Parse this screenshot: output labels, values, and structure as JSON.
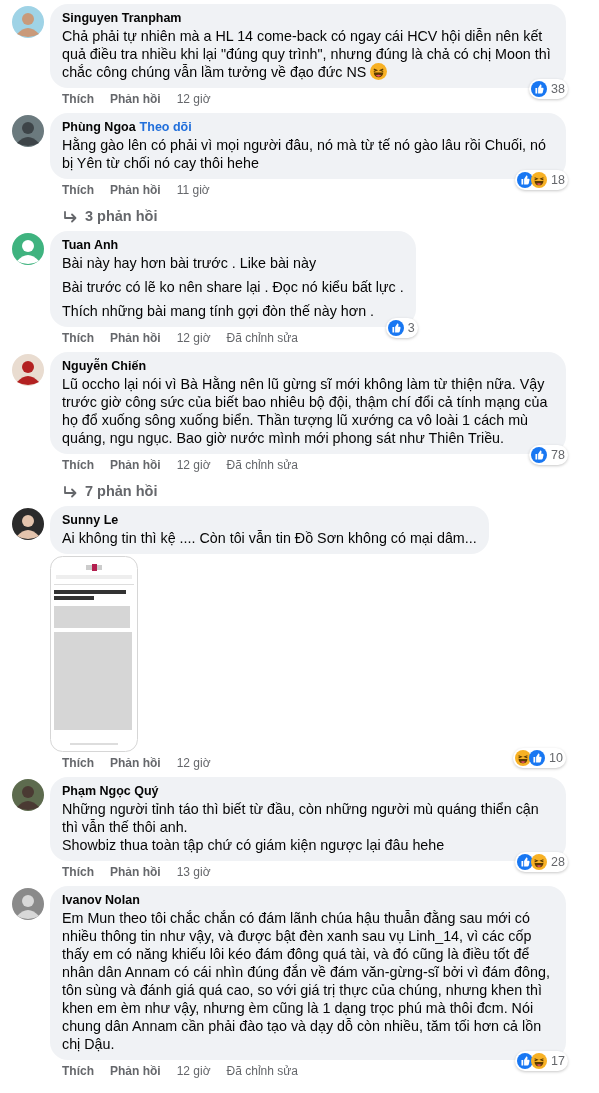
{
  "comments": [
    {
      "author": "Singuyen Tranpham",
      "paragraphs": [
        "Chả phải tự nhiên mà a HL 14 come-back có ngay cái HCV hội diễn nên kết quả điều tra nhiều khi lại \"đúng quy trình\", nhưng đúng là chả có chị Moon thì chắc công chúng vẫn lầm tưởng về đạo đức NS"
      ],
      "trailing_emoji": true,
      "like_label": "Thích",
      "reply_label": "Phản hồi",
      "time": "12 giờ",
      "reactions": [
        {
          "kind": "like"
        }
      ],
      "reaction_count": "38"
    },
    {
      "author": "Phùng Ngoa",
      "follow": "Theo dõi",
      "paragraphs": [
        "Hằng gào lên có phải vì mọi người đâu, nó mà từ tế nó gào lâu rồi Chuối, nó bị Yên từ chối nó cay thôi hehe"
      ],
      "trailing_emoji": false,
      "like_label": "Thích",
      "reply_label": "Phản hồi",
      "time": "11 giờ",
      "reactions": [
        {
          "kind": "like"
        },
        {
          "kind": "haha"
        }
      ],
      "reaction_count": "18",
      "replies": "3 phản hồi"
    },
    {
      "author": "Tuan Anh",
      "paragraphs": [
        "Bài này hay hơn bài trước . Like bài này",
        "Bài trước có lẽ ko nên share lại . Đọc nó kiểu bất lực .",
        "Thích những bài mang tính gợi đòn thế này hơn ."
      ],
      "trailing_emoji": false,
      "paragraph_gap": true,
      "like_label": "Thích",
      "reply_label": "Phản hồi",
      "time": "12 giờ",
      "edited": "Đã chỉnh sửa",
      "reactions": [
        {
          "kind": "like"
        }
      ],
      "reaction_count": "3"
    },
    {
      "author": "Nguyễn Chiến",
      "paragraphs": [
        "Lũ occho lại nói vì Bà Hằng nên lũ gừng sĩ mới không làm từ thiện nữa. Vậy trước giờ công sức của biết bao nhiêu bộ đội, thậm chí đổi cả tính mạng của họ đổ xuống sông xuống biển. Thần tượng lũ xướng ca vô loài 1 cách mù quáng, ngu ngục. Bao giờ nước mình mới phong sát như Thiên Triều."
      ],
      "trailing_emoji": false,
      "like_label": "Thích",
      "reply_label": "Phản hồi",
      "time": "12 giờ",
      "edited": "Đã chỉnh sửa",
      "reactions": [
        {
          "kind": "like"
        }
      ],
      "reaction_count": "78",
      "replies": "7 phản hồi"
    },
    {
      "author": "Sunny Le",
      "paragraphs": [
        "Ai không tin thì kệ .... Còn tôi vẫn tin Đồ Sơn không có mại dâm..."
      ],
      "trailing_emoji": false,
      "attachment": {
        "kind": "picture"
      },
      "like_label": "Thích",
      "reply_label": "Phản hồi",
      "time": "12 giờ",
      "reactions": [
        {
          "kind": "haha"
        },
        {
          "kind": "like"
        }
      ],
      "reaction_count": "10"
    },
    {
      "author": "Phạm Ngọc Quý",
      "paragraphs": [
        "Những người tỉnh táo thì biết từ đầu, còn những người mù quáng thiển cận thì vẫn thế thôi anh.",
        "Showbiz thua toàn tập chứ có giám kiện ngược lại đâu hehe"
      ],
      "trailing_emoji": false,
      "paragraph_gap": false,
      "like_label": "Thích",
      "reply_label": "Phản hồi",
      "time": "13 giờ",
      "reactions": [
        {
          "kind": "like"
        },
        {
          "kind": "haha"
        }
      ],
      "reaction_count": "28"
    },
    {
      "author": "Ivanov Nolan",
      "paragraphs": [
        "Em Mun theo tôi chắc chắn có đám lãnh chúa hậu thuẫn đằng sau mới có nhiều thông tin như vậy, và được bật đèn xanh sau vụ Linh_14, vì các cốp thấy em có năng khiếu lôi kéo đám đông quá tài, và đó cũng là điều tốt để nhân dân Annam có cái nhìn đúng đắn về đám văn-gừng-sĩ bởi vì đám đông, tôn sùng và đánh giá quá cao, so với giá trị thực của chúng, nhưng khen thì khen em èm như vậy, nhưng èm cũng là 1 dạng trọc phú mà thôi đcm. Nói chung dân Annam cần phải đào tạo và dạy dỗ còn nhiều, tăm tối hơn cả lồn chị Dậu."
      ],
      "trailing_emoji": false,
      "like_label": "Thích",
      "reply_label": "Phản hồi",
      "time": "12 giờ",
      "edited": "Đã chỉnh sửa",
      "reactions": [
        {
          "kind": "like"
        },
        {
          "kind": "haha"
        }
      ],
      "reaction_count": "17"
    }
  ]
}
